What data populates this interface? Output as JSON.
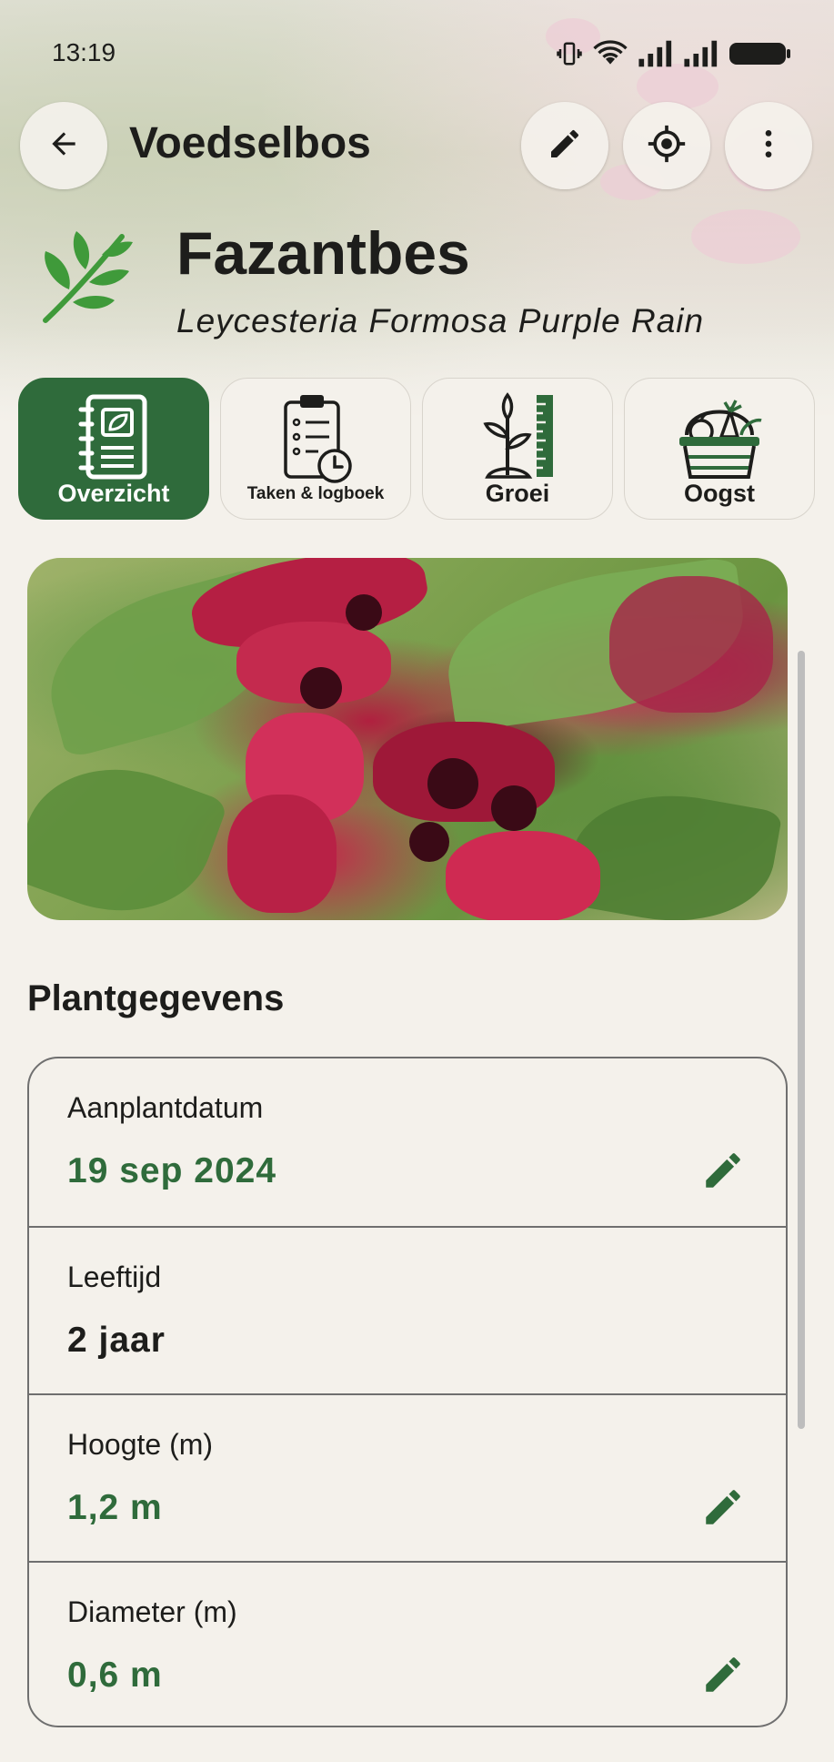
{
  "status_bar": {
    "time": "13:19",
    "icons": [
      "vibrate-icon",
      "wifi-icon",
      "signal-icon",
      "signal-icon",
      "battery-icon"
    ]
  },
  "app_bar": {
    "title": "Voedselbos",
    "back_icon": "arrow-left-icon",
    "actions": [
      "pencil-icon",
      "target-location-icon",
      "more-vert-icon"
    ]
  },
  "plant": {
    "name": "Fazantbes",
    "latin_name": "Leycesteria Formosa Purple Rain",
    "icon": "leaf-sprig-icon"
  },
  "tabs": [
    {
      "label": "Overzicht",
      "icon": "notebook-icon",
      "active": true
    },
    {
      "label": "Taken & logboek",
      "icon": "clipboard-clock-icon",
      "active": false
    },
    {
      "label": "Groei",
      "icon": "seedling-ruler-icon",
      "active": false
    },
    {
      "label": "Oogst",
      "icon": "harvest-basket-icon",
      "active": false
    }
  ],
  "section": {
    "title": "Plantgegevens"
  },
  "details": [
    {
      "label": "Aanplantdatum",
      "value": "19 sep 2024",
      "editable": true
    },
    {
      "label": "Leeftijd",
      "value": "2 jaar",
      "editable": false
    },
    {
      "label": "Hoogte (m)",
      "value": "1,2 m",
      "editable": true
    },
    {
      "label": "Diameter (m)",
      "value": "0,6 m",
      "editable": true
    }
  ],
  "colors": {
    "accent": "#2f6b3b",
    "background": "#f4f1eb",
    "text": "#1d1d1b",
    "leaf": "#3f9a3a"
  }
}
